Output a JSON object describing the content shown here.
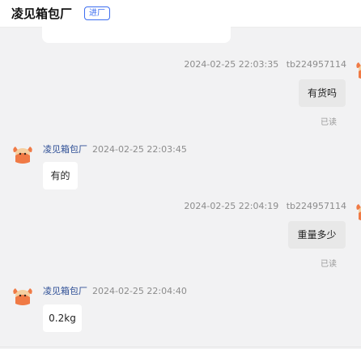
{
  "header": {
    "shop_name": "凌见箱包厂",
    "tag": "进厂"
  },
  "messages": [
    {
      "side": "right",
      "timestamp": "2024-02-25 22:03:35",
      "sender": "tb224957114",
      "text": "有货吗",
      "status": "已读"
    },
    {
      "side": "left",
      "sender": "凌见箱包厂",
      "timestamp": "2024-02-25 22:03:45",
      "text": "有的"
    },
    {
      "side": "right",
      "timestamp": "2024-02-25 22:04:19",
      "sender": "tb224957114",
      "text": "重量多少",
      "status": "已读"
    },
    {
      "side": "left",
      "sender": "凌见箱包厂",
      "timestamp": "2024-02-25 22:04:40",
      "text": "0.2kg"
    }
  ],
  "colors": {
    "background": "#f2f2f3",
    "tag_blue": "#3c6df0",
    "seller_name": "#2e4f96",
    "avatar_orange": "#f07a45"
  },
  "icons": {
    "avatar": "cartoon-monkey-avatar-icon"
  }
}
